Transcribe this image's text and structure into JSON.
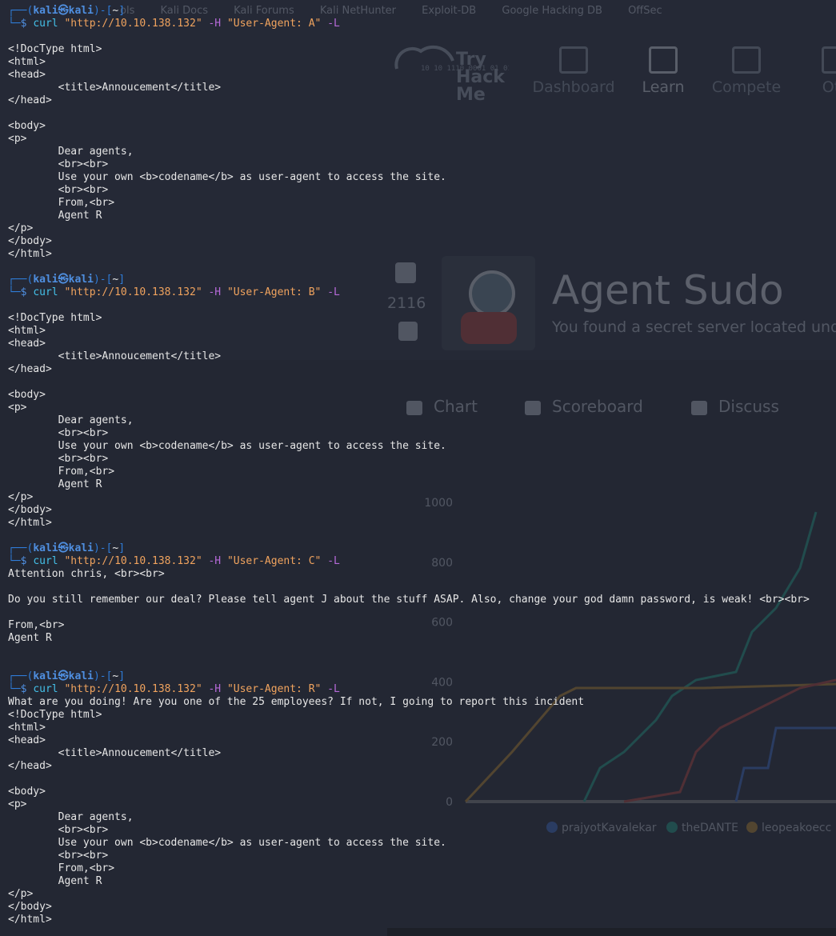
{
  "background_browser": {
    "bookmarks": [
      "ols",
      "Kali Docs",
      "Kali Forums",
      "Kali NetHunter",
      "Exploit-DB",
      "Google Hacking DB",
      "OffSec"
    ],
    "logo_text": [
      "Try",
      "Hack",
      "Me"
    ],
    "logo_digits": "10 10 1110 0001 01 010",
    "nav": [
      {
        "label": "Dashboard",
        "icon": "dashboard-icon"
      },
      {
        "label": "Learn",
        "icon": "book-icon"
      },
      {
        "label": "Compete",
        "icon": "trophy-icon"
      },
      {
        "label": "Oth",
        "icon": "more-icon"
      }
    ],
    "votes": "2116",
    "room_title": "Agent Sudo",
    "room_subtitle": "You found a secret server located und",
    "tabs": [
      {
        "label": "Chart",
        "icon": "chart-icon"
      },
      {
        "label": "Scoreboard",
        "icon": "trophy-icon"
      },
      {
        "label": "Discuss",
        "icon": "chat-icon"
      }
    ],
    "colors": {
      "learn_active": "#d7dde7"
    }
  },
  "chart_data": {
    "type": "line",
    "y_ticks": [
      "1000",
      "800",
      "600",
      "400",
      "200",
      "0"
    ],
    "ylim": [
      0,
      1000
    ],
    "series": [
      {
        "name": "prajyotKavalekar",
        "color": "#3a6fd0"
      },
      {
        "name": "theDANTE",
        "color": "#1fa28a"
      },
      {
        "name": "leopeakoecc",
        "color": "#c08a2a"
      }
    ]
  },
  "terminal": {
    "prompt": {
      "user": "kali",
      "host": "kali",
      "path": "~"
    },
    "sessions": [
      {
        "command": "curl",
        "url": "\"http://10.10.138.132\"",
        "header_flag": "-H",
        "header": "\"User-Agent: A\"",
        "follow_flag": "-L",
        "output": [
          "",
          "<!DocType html>",
          "<html>",
          "<head>",
          "        <title>Annoucement</title>",
          "</head>",
          "",
          "<body>",
          "<p>",
          "        Dear agents,",
          "        <br><br>",
          "        Use your own <b>codename</b> as user-agent to access the site.",
          "        <br><br>",
          "        From,<br>",
          "        Agent R",
          "</p>",
          "</body>",
          "</html>",
          ""
        ]
      },
      {
        "command": "curl",
        "url": "\"http://10.10.138.132\"",
        "header_flag": "-H",
        "header": "\"User-Agent: B\"",
        "follow_flag": "-L",
        "output": [
          "",
          "<!DocType html>",
          "<html>",
          "<head>",
          "        <title>Annoucement</title>",
          "</head>",
          "",
          "<body>",
          "<p>",
          "        Dear agents,",
          "        <br><br>",
          "        Use your own <b>codename</b> as user-agent to access the site.",
          "        <br><br>",
          "        From,<br>",
          "        Agent R",
          "</p>",
          "</body>",
          "</html>",
          ""
        ]
      },
      {
        "command": "curl",
        "url": "\"http://10.10.138.132\"",
        "header_flag": "-H",
        "header": "\"User-Agent: C\"",
        "follow_flag": "-L",
        "output": [
          "Attention chris, <br><br>",
          "",
          "Do you still remember our deal? Please tell agent J about the stuff ASAP. Also, change your god damn password, is weak! <br><br>",
          "",
          "From,<br>",
          "Agent R",
          "",
          ""
        ]
      },
      {
        "command": "curl",
        "url": "\"http://10.10.138.132\"",
        "header_flag": "-H",
        "header": "\"User-Agent: R\"",
        "follow_flag": "-L",
        "output": [
          "What are you doing! Are you one of the 25 employees? If not, I going to report this incident",
          "<!DocType html>",
          "<html>",
          "<head>",
          "        <title>Annoucement</title>",
          "</head>",
          "",
          "<body>",
          "<p>",
          "        Dear agents,",
          "        <br><br>",
          "        Use your own <b>codename</b> as user-agent to access the site.",
          "        <br><br>",
          "        From,<br>",
          "        Agent R",
          "</p>",
          "</body>",
          "</html>"
        ]
      }
    ]
  }
}
